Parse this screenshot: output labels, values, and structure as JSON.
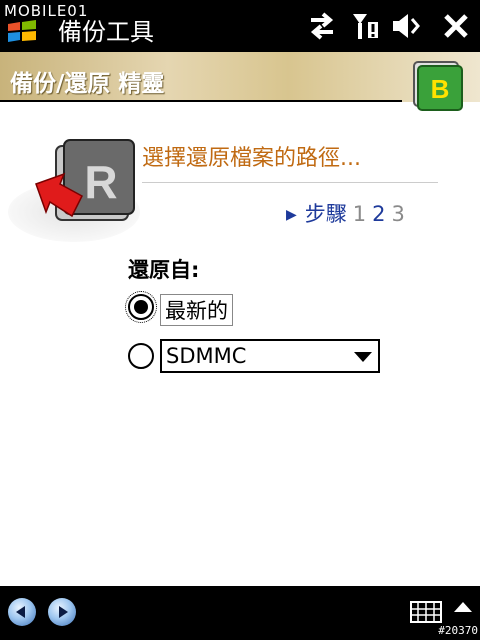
{
  "statusbar": {
    "watermark": "MOBILE01",
    "app_title": "備份工具"
  },
  "banner": {
    "title": "備份/還原 精靈"
  },
  "wizard": {
    "heading": "選擇還原檔案的路徑...",
    "steps_label": "步驟",
    "step1": "1",
    "step2": "2",
    "step3": "3",
    "current_step": 2
  },
  "restore": {
    "from_label": "還原自:",
    "option_latest": "最新的",
    "option_card": "SDMMC",
    "selected": "最新的"
  },
  "footer": {
    "watermark": "#20370"
  },
  "colors": {
    "heading": "#c06a12",
    "step_link": "#1e3a9b",
    "banner_bg": "#d8c58f"
  }
}
